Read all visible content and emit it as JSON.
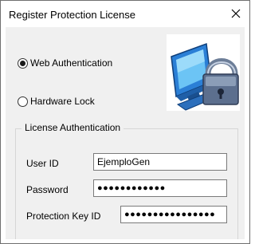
{
  "window": {
    "title": "Register Protection License"
  },
  "radios": {
    "web": {
      "label": "Web Authentication",
      "checked": true
    },
    "hardware": {
      "label": "Hardware Lock",
      "checked": false
    }
  },
  "license": {
    "group_title": "License Authentication",
    "user_id": {
      "label": "User ID",
      "value": "EjemploGen"
    },
    "password": {
      "label": "Password",
      "value": "●●●●●●●●●●●●"
    },
    "protection_key": {
      "label": "Protection Key ID",
      "value": "●●●●●●●●●●●●●●●●"
    }
  },
  "icons": {
    "close": "close-icon",
    "logo": "computer-padlock-icon"
  }
}
